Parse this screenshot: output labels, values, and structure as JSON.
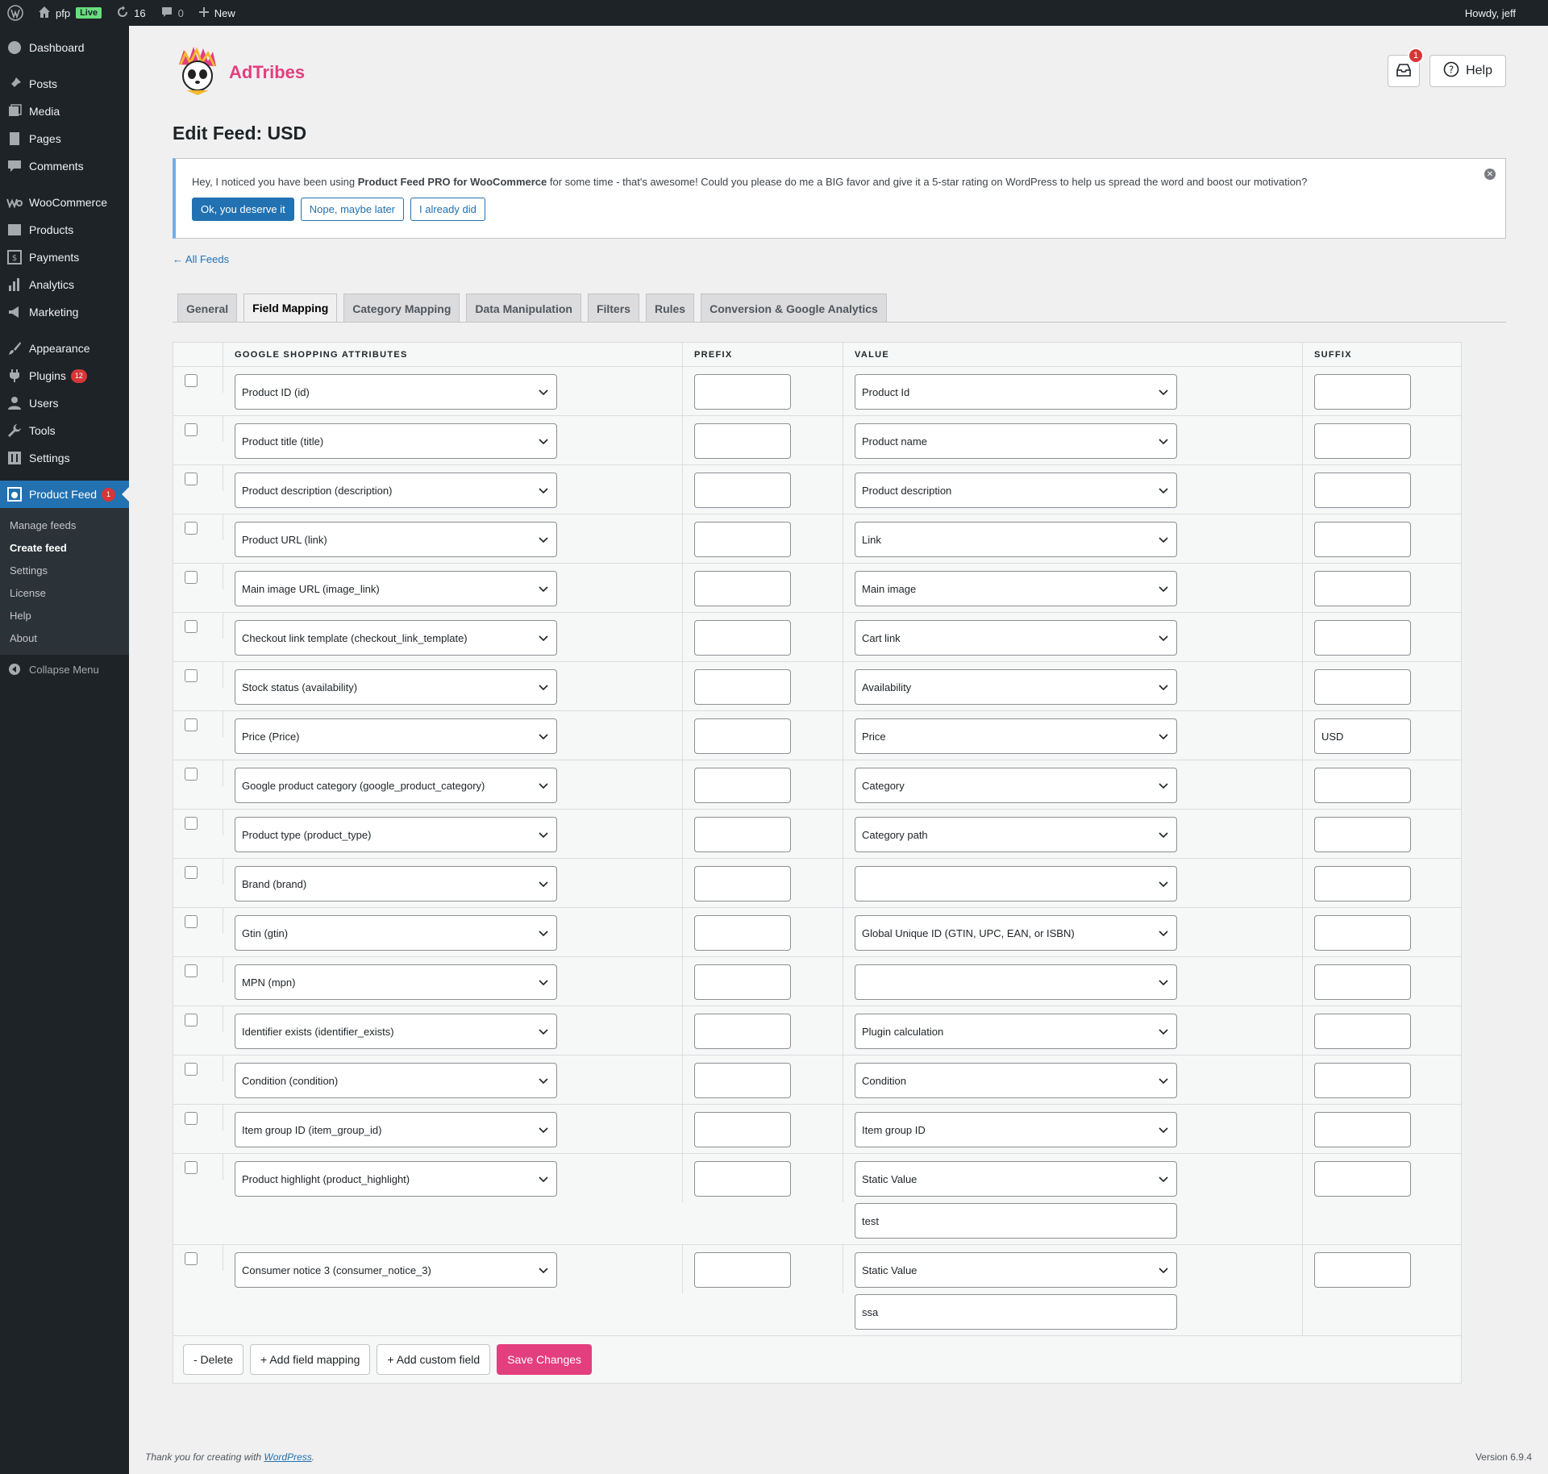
{
  "admin_bar": {
    "site_name": "pfp",
    "live_label": "Live",
    "updates_count": "16",
    "comments_count": "0",
    "new_label": "New",
    "howdy": "Howdy, jeff"
  },
  "sidebar": {
    "items": [
      {
        "label": "Dashboard"
      },
      {
        "label": "Posts"
      },
      {
        "label": "Media"
      },
      {
        "label": "Pages"
      },
      {
        "label": "Comments"
      },
      {
        "label": "WooCommerce"
      },
      {
        "label": "Products"
      },
      {
        "label": "Payments"
      },
      {
        "label": "Analytics"
      },
      {
        "label": "Marketing"
      },
      {
        "label": "Appearance"
      },
      {
        "label": "Plugins",
        "badge": "12"
      },
      {
        "label": "Users"
      },
      {
        "label": "Tools"
      },
      {
        "label": "Settings"
      },
      {
        "label": "Product Feed",
        "badge": "1"
      }
    ],
    "submenu": [
      "Manage feeds",
      "Create feed",
      "Settings",
      "License",
      "Help",
      "About"
    ],
    "collapse_label": "Collapse Menu"
  },
  "header": {
    "brand": "AdTribes",
    "inbox_count": "1",
    "help_label": "Help"
  },
  "page_title": "Edit Feed: USD",
  "notice": {
    "text_before": "Hey, I noticed you have been using ",
    "text_bold": "Product Feed PRO for WooCommerce",
    "text_after": " for some time - that's awesome! Could you please do me a BIG favor and give it a 5-star rating on WordPress to help us spread the word and boost our motivation?",
    "btn_yes": "Ok, you deserve it",
    "btn_later": "Nope, maybe later",
    "btn_done": "I already did"
  },
  "back_link": "← All Feeds",
  "tabs": [
    "General",
    "Field Mapping",
    "Category Mapping",
    "Data Manipulation",
    "Filters",
    "Rules",
    "Conversion & Google Analytics"
  ],
  "table": {
    "headers": {
      "attribute": "GOOGLE SHOPPING ATTRIBUTES",
      "prefix": "PREFIX",
      "value": "VALUE",
      "suffix": "SUFFIX"
    },
    "rows": [
      {
        "attribute": "Product ID (id)",
        "prefix": "",
        "value": "Product Id",
        "suffix": ""
      },
      {
        "attribute": "Product title (title)",
        "prefix": "",
        "value": "Product name",
        "suffix": ""
      },
      {
        "attribute": "Product description (description)",
        "prefix": "",
        "value": "Product description",
        "suffix": ""
      },
      {
        "attribute": "Product URL (link)",
        "prefix": "",
        "value": "Link",
        "suffix": ""
      },
      {
        "attribute": "Main image URL (image_link)",
        "prefix": "",
        "value": "Main image",
        "suffix": ""
      },
      {
        "attribute": "Checkout link template (checkout_link_template)",
        "prefix": "",
        "value": "Cart link",
        "suffix": ""
      },
      {
        "attribute": "Stock status (availability)",
        "prefix": "",
        "value": "Availability",
        "suffix": ""
      },
      {
        "attribute": "Price (Price)",
        "prefix": "",
        "value": "Price",
        "suffix": "USD"
      },
      {
        "attribute": "Google product category (google_product_category)",
        "prefix": "",
        "value": "Category",
        "suffix": ""
      },
      {
        "attribute": "Product type (product_type)",
        "prefix": "",
        "value": "Category path",
        "suffix": ""
      },
      {
        "attribute": "Brand (brand)",
        "prefix": "",
        "value": "",
        "suffix": ""
      },
      {
        "attribute": "Gtin (gtin)",
        "prefix": "",
        "value": "Global Unique ID (GTIN, UPC, EAN, or ISBN)",
        "suffix": ""
      },
      {
        "attribute": "MPN (mpn)",
        "prefix": "",
        "value": "",
        "suffix": ""
      },
      {
        "attribute": "Identifier exists (identifier_exists)",
        "prefix": "",
        "value": "Plugin calculation",
        "suffix": ""
      },
      {
        "attribute": "Condition (condition)",
        "prefix": "",
        "value": "Condition",
        "suffix": ""
      },
      {
        "attribute": "Item group ID (item_group_id)",
        "prefix": "",
        "value": "Item group ID",
        "suffix": ""
      },
      {
        "attribute": "Product highlight (product_highlight)",
        "prefix": "",
        "value": "Static Value",
        "static": "test",
        "suffix": ""
      },
      {
        "attribute": "Consumer notice 3 (consumer_notice_3)",
        "prefix": "",
        "value": "Static Value",
        "static": "ssa",
        "suffix": ""
      }
    ]
  },
  "actions": {
    "delete": "- Delete",
    "add_mapping": "+ Add field mapping",
    "add_custom": "+ Add custom field",
    "save": "Save Changes"
  },
  "footer": {
    "thanks_prefix": "Thank you for creating with ",
    "wordpress_link": "WordPress",
    "thanks_suffix": ".",
    "version": "Version 6.9.4"
  },
  "colors": {
    "accent": "#2271b1",
    "brand": "#e33e7e",
    "admin_dark": "#1d2327"
  }
}
